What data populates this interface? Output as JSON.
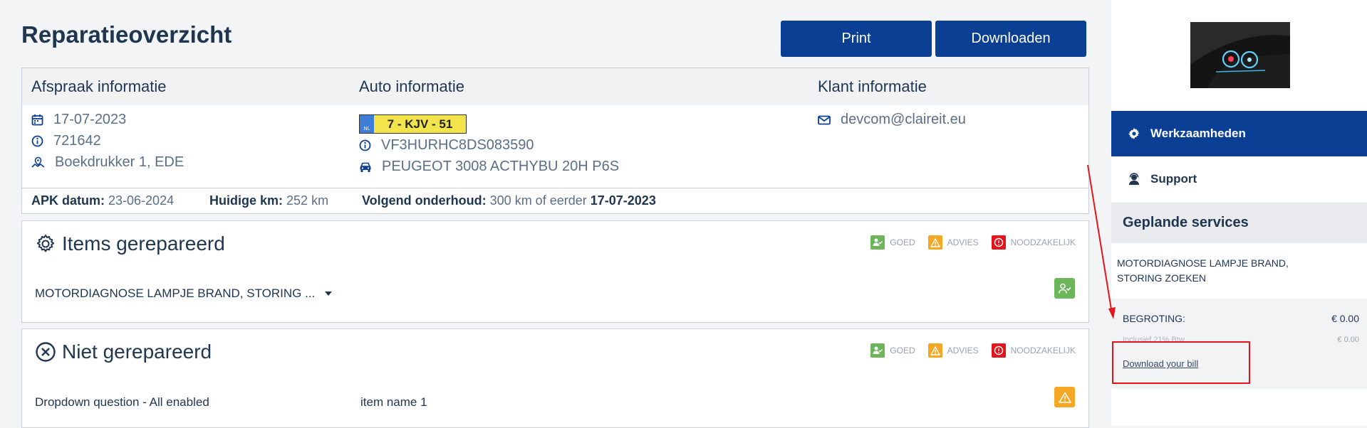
{
  "header": {
    "title": "Reparatieoverzicht",
    "print_label": "Print",
    "download_label": "Downloaden"
  },
  "info": {
    "col_appointment": "Afspraak informatie",
    "col_car": "Auto informatie",
    "col_client": "Klant informatie",
    "date": "17-07-2023",
    "number": "721642",
    "address": "Boekdrukker 1, EDE",
    "plate_country": "NL",
    "plate": "7 - KJV - 51",
    "vin": "VF3HURHC8DS083590",
    "car_model": "PEUGEOT 3008 ACTHYBU 20H P6S",
    "email": "devcom@claireit.eu",
    "apk_label": "APK datum:",
    "apk_value": "23-06-2024",
    "km_label": "Huidige km:",
    "km_value": "252 km",
    "next_label": "Volgend onderhoud:",
    "next_value": "300 km of eerder",
    "next_date": "17-07-2023"
  },
  "legend": {
    "good": "GOED",
    "advice": "ADVIES",
    "needed": "NOODZAKELIJK"
  },
  "repaired": {
    "title": "Items gerepareerd",
    "item": "MOTORDIAGNOSE LAMPJE BRAND, STORING ..."
  },
  "not_repaired": {
    "title": "Niet gerepareerd",
    "question": "Dropdown question - All enabled",
    "item_name": "item name 1"
  },
  "sidebar": {
    "nav_work": "Werkzaamheden",
    "nav_support": "Support",
    "planned_title": "Geplande services",
    "service_line1": "MOTORDIAGNOSE LAMPJE BRAND,",
    "service_line2": "STORING ZOEKEN",
    "budget_label": "BEGROTING:",
    "budget_value": "€ 0.00",
    "incl_label": "Inclusief 21% Btw",
    "incl_value": "€ 0.00",
    "bill_link": "Download your bill"
  },
  "colors": {
    "primary": "#0b3f94",
    "text": "#1f3550",
    "good": "#6db55b",
    "advice": "#f5a623",
    "needed": "#e4141b",
    "annotation": "#e4141b"
  }
}
